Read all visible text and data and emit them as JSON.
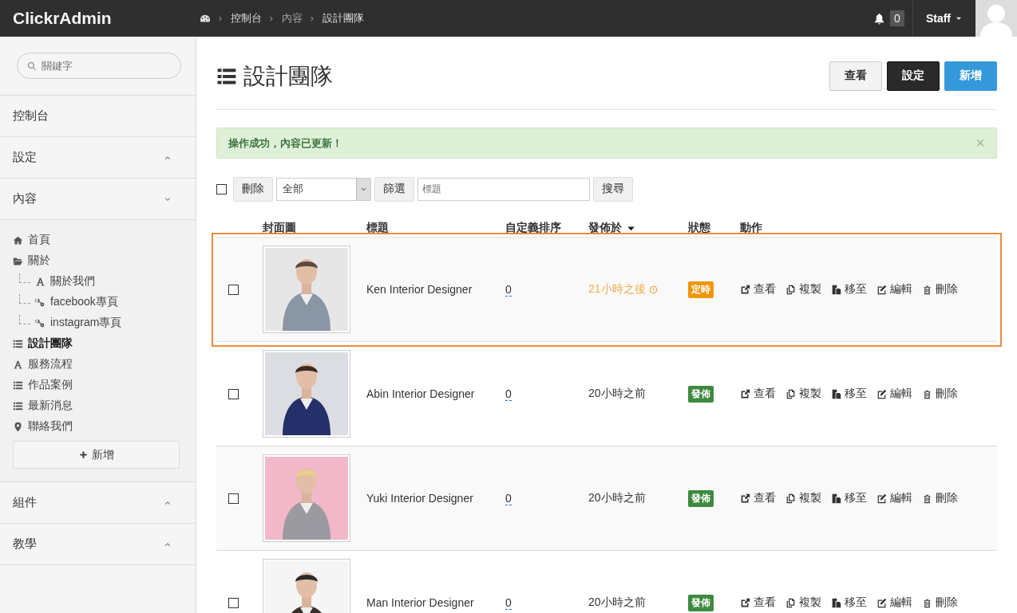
{
  "app": {
    "brand": "ClickrAdmin"
  },
  "breadcrumb": [
    {
      "label": "控制台"
    },
    {
      "label": "內容"
    },
    {
      "label": "設計團隊"
    }
  ],
  "notifications": {
    "count": "0"
  },
  "user": {
    "name": "Staff"
  },
  "sidebar": {
    "search": {
      "placeholder": "關鍵字"
    },
    "sections": [
      {
        "label": "控制台",
        "kind": "link"
      },
      {
        "label": "設定",
        "kind": "group",
        "expanded": false
      },
      {
        "label": "內容",
        "kind": "group",
        "expanded": true,
        "items": [
          {
            "label": "首頁",
            "kind": "home",
            "selected": false
          },
          {
            "label": "關於",
            "kind": "folder",
            "selected": false,
            "children": [
              {
                "label": "關於我們",
                "kind": "page",
                "selected": false
              },
              {
                "label": "facebook專頁",
                "kind": "link",
                "selected": false
              },
              {
                "label": "instagram專頁",
                "kind": "link",
                "selected": false
              }
            ]
          },
          {
            "label": "設計團隊",
            "kind": "list",
            "selected": true
          },
          {
            "label": "服務流程",
            "kind": "page",
            "selected": false
          },
          {
            "label": "作品案例",
            "kind": "list",
            "selected": false
          },
          {
            "label": "最新消息",
            "kind": "list",
            "selected": false
          },
          {
            "label": "聯絡我們",
            "kind": "location",
            "selected": false
          }
        ],
        "add_button": "新增"
      },
      {
        "label": "組件",
        "kind": "group",
        "expanded": false
      },
      {
        "label": "教學",
        "kind": "group",
        "expanded": false
      }
    ]
  },
  "page": {
    "title": "設計團隊",
    "buttons": [
      {
        "label": "查看",
        "kind": "default"
      },
      {
        "label": "設定",
        "kind": "dark"
      },
      {
        "label": "新增",
        "kind": "primary"
      }
    ]
  },
  "alert": {
    "message": "操作成功，內容已更新！",
    "close": "×"
  },
  "toolbar": {
    "select_all": {
      "checked": false
    },
    "delete": "刪除",
    "status_select": {
      "value": "全部"
    },
    "filter": "篩選",
    "search": {
      "placeholder": "標題"
    },
    "search_button": "搜尋"
  },
  "table": {
    "columns": [
      {
        "label": "封面圖",
        "sorted": false
      },
      {
        "label": "標題",
        "sorted": false
      },
      {
        "label": "自定義排序",
        "sorted": false
      },
      {
        "label": "發佈於",
        "sorted": true
      },
      {
        "label": "狀態",
        "sorted": false
      },
      {
        "label": "動作",
        "sorted": false
      }
    ],
    "rows": [
      {
        "checked": false,
        "highlighted": true,
        "picture": {
          "kind": "picture"
        },
        "title": "Ken Interior Designer",
        "order": "0",
        "published": "21小時之後",
        "status": {
          "label": "定時",
          "kind": "scheduled"
        },
        "actions": [
          {
            "label": "查看",
            "kind": "view"
          },
          {
            "label": "複製",
            "kind": "copy"
          },
          {
            "label": "移至",
            "kind": "move"
          },
          {
            "label": "編輯",
            "kind": "edit"
          },
          {
            "label": "刪除",
            "kind": "delete"
          }
        ]
      },
      {
        "checked": false,
        "highlighted": false,
        "picture": {
          "kind": "picture"
        },
        "title": "Abin Interior Designer",
        "order": "0",
        "published": "20小時之前",
        "status": {
          "label": "發佈",
          "kind": "published"
        },
        "actions": [
          {
            "label": "查看",
            "kind": "view"
          },
          {
            "label": "複製",
            "kind": "copy"
          },
          {
            "label": "移至",
            "kind": "move"
          },
          {
            "label": "編輯",
            "kind": "edit"
          },
          {
            "label": "刪除",
            "kind": "delete"
          }
        ]
      },
      {
        "checked": false,
        "highlighted": false,
        "picture": {
          "kind": "picture"
        },
        "title": "Yuki Interior Designer",
        "order": "0",
        "published": "20小時之前",
        "status": {
          "label": "發佈",
          "kind": "published"
        },
        "actions": [
          {
            "label": "查看",
            "kind": "view"
          },
          {
            "label": "複製",
            "kind": "copy"
          },
          {
            "label": "移至",
            "kind": "move"
          },
          {
            "label": "編輯",
            "kind": "edit"
          },
          {
            "label": "刪除",
            "kind": "delete"
          }
        ]
      },
      {
        "checked": false,
        "highlighted": false,
        "picture": {
          "kind": "picture"
        },
        "title": "Man Interior Designer",
        "order": "0",
        "published": "20小時之前",
        "status": {
          "label": "發佈",
          "kind": "published"
        },
        "actions": [
          {
            "label": "查看",
            "kind": "view"
          },
          {
            "label": "複製",
            "kind": "copy"
          },
          {
            "label": "移至",
            "kind": "move"
          },
          {
            "label": "編輯",
            "kind": "edit"
          },
          {
            "label": "刪除",
            "kind": "delete"
          }
        ]
      }
    ]
  }
}
